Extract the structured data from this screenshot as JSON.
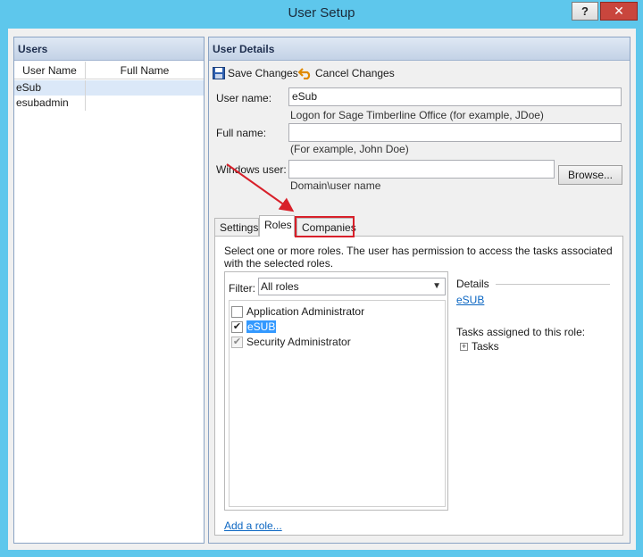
{
  "window": {
    "title": "User Setup",
    "help": "?",
    "close": "✕"
  },
  "users_panel": {
    "header": "Users",
    "columns": [
      "User Name",
      "Full Name"
    ],
    "rows": [
      {
        "user_name": "eSub",
        "full_name": ""
      },
      {
        "user_name": "esubadmin",
        "full_name": ""
      }
    ]
  },
  "details": {
    "header": "User Details",
    "save_label": "Save Changes",
    "cancel_label": "Cancel Changes",
    "user_name_label": "User name:",
    "user_name_value": "eSub",
    "user_name_hint": "Logon for Sage Timberline Office (for example, JDoe)",
    "full_name_label": "Full name:",
    "full_name_value": "",
    "full_name_hint": "(For example, John Doe)",
    "windows_user_label": "Windows user:",
    "windows_user_value": "",
    "windows_user_hint": "Domain\\user name",
    "browse_label": "Browse..."
  },
  "tabs": [
    "Settings",
    "Roles",
    "Companies"
  ],
  "roles_tab": {
    "description": "Select one or more roles. The user has permission to access the tasks associated with the selected roles.",
    "filter_label": "Filter:",
    "filter_value": "All roles",
    "roles": [
      {
        "label": "Application Administrator",
        "checked": false
      },
      {
        "label": "eSUB",
        "checked": true
      },
      {
        "label": "Security Administrator",
        "checked": true
      }
    ],
    "details_title": "Details",
    "details_link": "eSUB",
    "tasks_label": "Tasks assigned to this role:",
    "tasks_node": "Tasks",
    "add_role": "Add a role..."
  },
  "colors": {
    "title_bar": "#5ec7ec",
    "close_button": "#c9463d",
    "annotation": "#d8202a",
    "link": "#0b66c2"
  }
}
